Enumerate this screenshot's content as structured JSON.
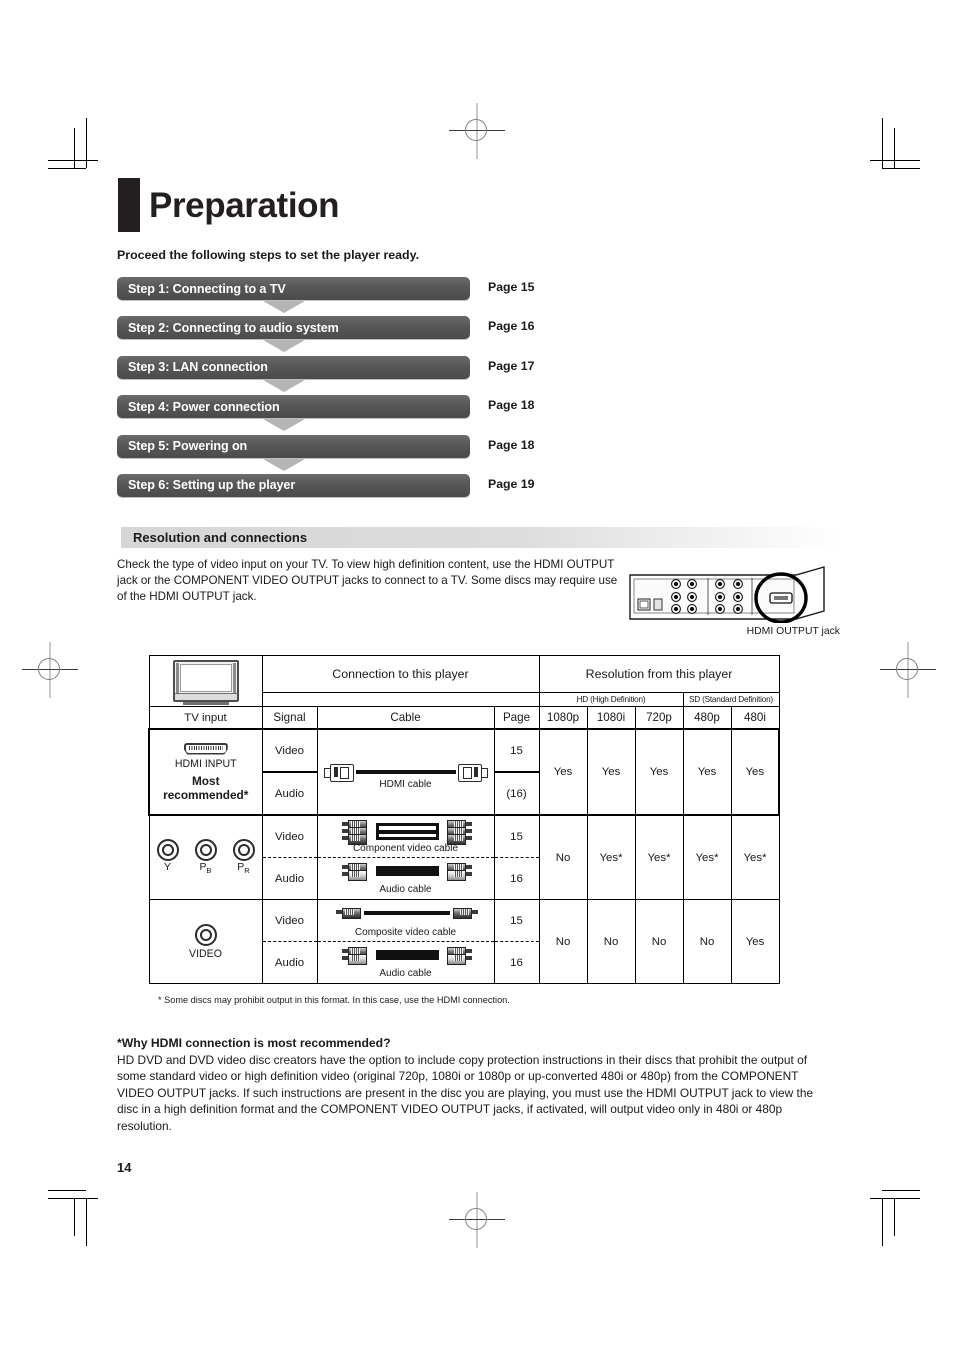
{
  "page": {
    "title": "Preparation",
    "intro": "Proceed the following steps to set the player ready.",
    "number": "14"
  },
  "steps": [
    {
      "label": "Step 1: Connecting to a TV",
      "page": "Page 15"
    },
    {
      "label": "Step 2: Connecting to audio system",
      "page": "Page 16"
    },
    {
      "label": "Step 3: LAN connection",
      "page": "Page 17"
    },
    {
      "label": "Step 4: Power connection",
      "page": "Page 18"
    },
    {
      "label": "Step 5: Powering on",
      "page": "Page 18"
    },
    {
      "label": "Step 6: Setting up the player",
      "page": "Page 19"
    }
  ],
  "section": {
    "heading": "Resolution and connections",
    "paragraph": "Check the type of video input on your TV. To view high definition content, use the HDMI OUTPUT jack or the COMPONENT VIDEO OUTPUT jacks to connect to a TV. Some discs may require use of the HDMI OUTPUT jack.",
    "rear_panel_caption": "HDMI OUTPUT jack"
  },
  "table": {
    "header": {
      "tv_input": "TV input",
      "connection_group": "Connection to this player",
      "resolution_group": "Resolution from this player",
      "hd_group": "HD (High Definition)",
      "sd_group": "SD (Standard Definition)",
      "signal": "Signal",
      "cable": "Cable",
      "page": "Page",
      "resolutions": [
        "1080p",
        "1080i",
        "720p",
        "480p",
        "480i"
      ]
    },
    "rows": [
      {
        "input_label": "HDMI INPUT",
        "input_note": "Most recommended*",
        "input_icon": "hdmi-port-icon",
        "signals": [
          {
            "name": "Video",
            "cable": "HDMI cable",
            "cable_icon": "hdmi-cable-icon",
            "page": "15"
          },
          {
            "name": "Audio",
            "cable": "",
            "cable_icon": "",
            "page": "(16)"
          }
        ],
        "results": [
          "Yes",
          "Yes",
          "Yes",
          "Yes",
          "Yes"
        ]
      },
      {
        "input_label": "",
        "input_note": "",
        "input_icon": "component-jacks-icon",
        "jacks": [
          {
            "letter": "Y",
            "sub": ""
          },
          {
            "letter": "P",
            "sub": "B"
          },
          {
            "letter": "P",
            "sub": "R"
          }
        ],
        "signals": [
          {
            "name": "Video",
            "cable": "Component video cable",
            "cable_icon": "component-video-cable-icon",
            "page": "15"
          },
          {
            "name": "Audio",
            "cable": "Audio cable",
            "cable_icon": "audio-cable-icon",
            "page": "16"
          }
        ],
        "results": [
          "No",
          "Yes*",
          "Yes*",
          "Yes*",
          "Yes*"
        ]
      },
      {
        "input_label": "VIDEO",
        "input_note": "",
        "input_icon": "composite-jack-icon",
        "signals": [
          {
            "name": "Video",
            "cable": "Composite video cable",
            "cable_icon": "composite-video-cable-icon",
            "page": "15"
          },
          {
            "name": "Audio",
            "cable": "Audio cable",
            "cable_icon": "audio-cable-icon",
            "page": "16"
          }
        ],
        "results": [
          "No",
          "No",
          "No",
          "No",
          "Yes"
        ]
      }
    ],
    "footnote": "* Some discs may prohibit output in this format. In this case, use the HDMI connection."
  },
  "why": {
    "heading": "*Why HDMI connection is most recommended?",
    "body": "HD DVD and DVD video disc creators have the option to include copy protection instructions in their discs that prohibit the output of some standard video or high definition video (original 720p, 1080i or 1080p or up-converted 480i or 480p) from the COMPONENT VIDEO OUTPUT jacks. If such instructions are present in the disc you are playing, you must use the HDMI OUTPUT jack to view the disc in a high definition format and the COMPONENT VIDEO OUTPUT jacks, if activated, will output video only in 480i or 480p resolution."
  }
}
